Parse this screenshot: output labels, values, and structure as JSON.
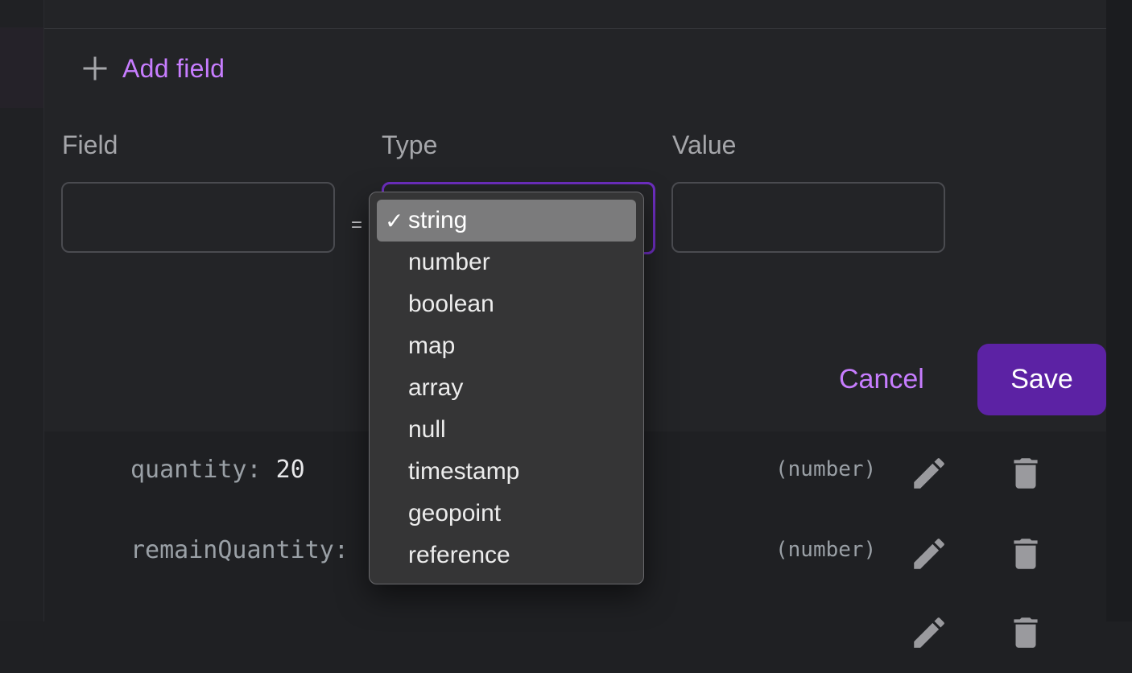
{
  "add_field": {
    "label": "Add field",
    "icon": "plus-icon"
  },
  "form": {
    "field_label": "Field",
    "type_label": "Type",
    "value_label": "Value",
    "equals": "=",
    "field_value": "",
    "value_value": "",
    "type_value": "string"
  },
  "actions": {
    "cancel": "Cancel",
    "save": "Save"
  },
  "colors": {
    "accent": "#c77dff",
    "primary_button": "#5c22a4",
    "focus_border": "#6d2ec0"
  },
  "type_dropdown": {
    "check": "✓",
    "options": [
      "string",
      "number",
      "boolean",
      "map",
      "array",
      "null",
      "timestamp",
      "geopoint",
      "reference"
    ]
  },
  "rows": [
    {
      "key": "quantity:",
      "value": "20",
      "type": "(number)"
    },
    {
      "key": "remainQuantity:",
      "value": "",
      "type": "(number)"
    }
  ]
}
